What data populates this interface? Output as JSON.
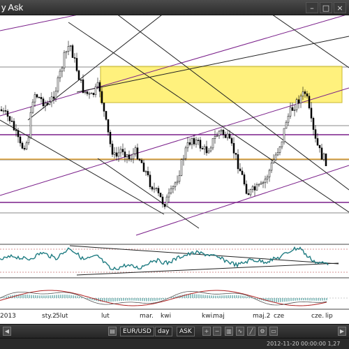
{
  "window": {
    "title": "y Ask",
    "buttons": [
      "–",
      "□",
      "×"
    ]
  },
  "chart": {
    "date_labels": [
      "2013",
      "sty.2",
      "5lut",
      "lut",
      "mar.",
      "kwi",
      "kwi.",
      "maj",
      "maj.2",
      "cze",
      "cze.",
      "lip"
    ],
    "colors": {
      "candle": "#000000",
      "resistance_zone": "#ffee66",
      "channel_purple": "#7a1f8a",
      "trend_black": "#222222",
      "support_orange": "#e0a030",
      "oscillator_teal": "#1f7c82",
      "macd_red": "#b02020",
      "macd_histogram": "#2a8a8a"
    }
  },
  "toolbar": {
    "symbol": "EUR/USD",
    "timeframe": "day",
    "price_type": "ASK"
  },
  "statusbar": {
    "text": "2012-11-20 00:00:00  1,27"
  }
}
